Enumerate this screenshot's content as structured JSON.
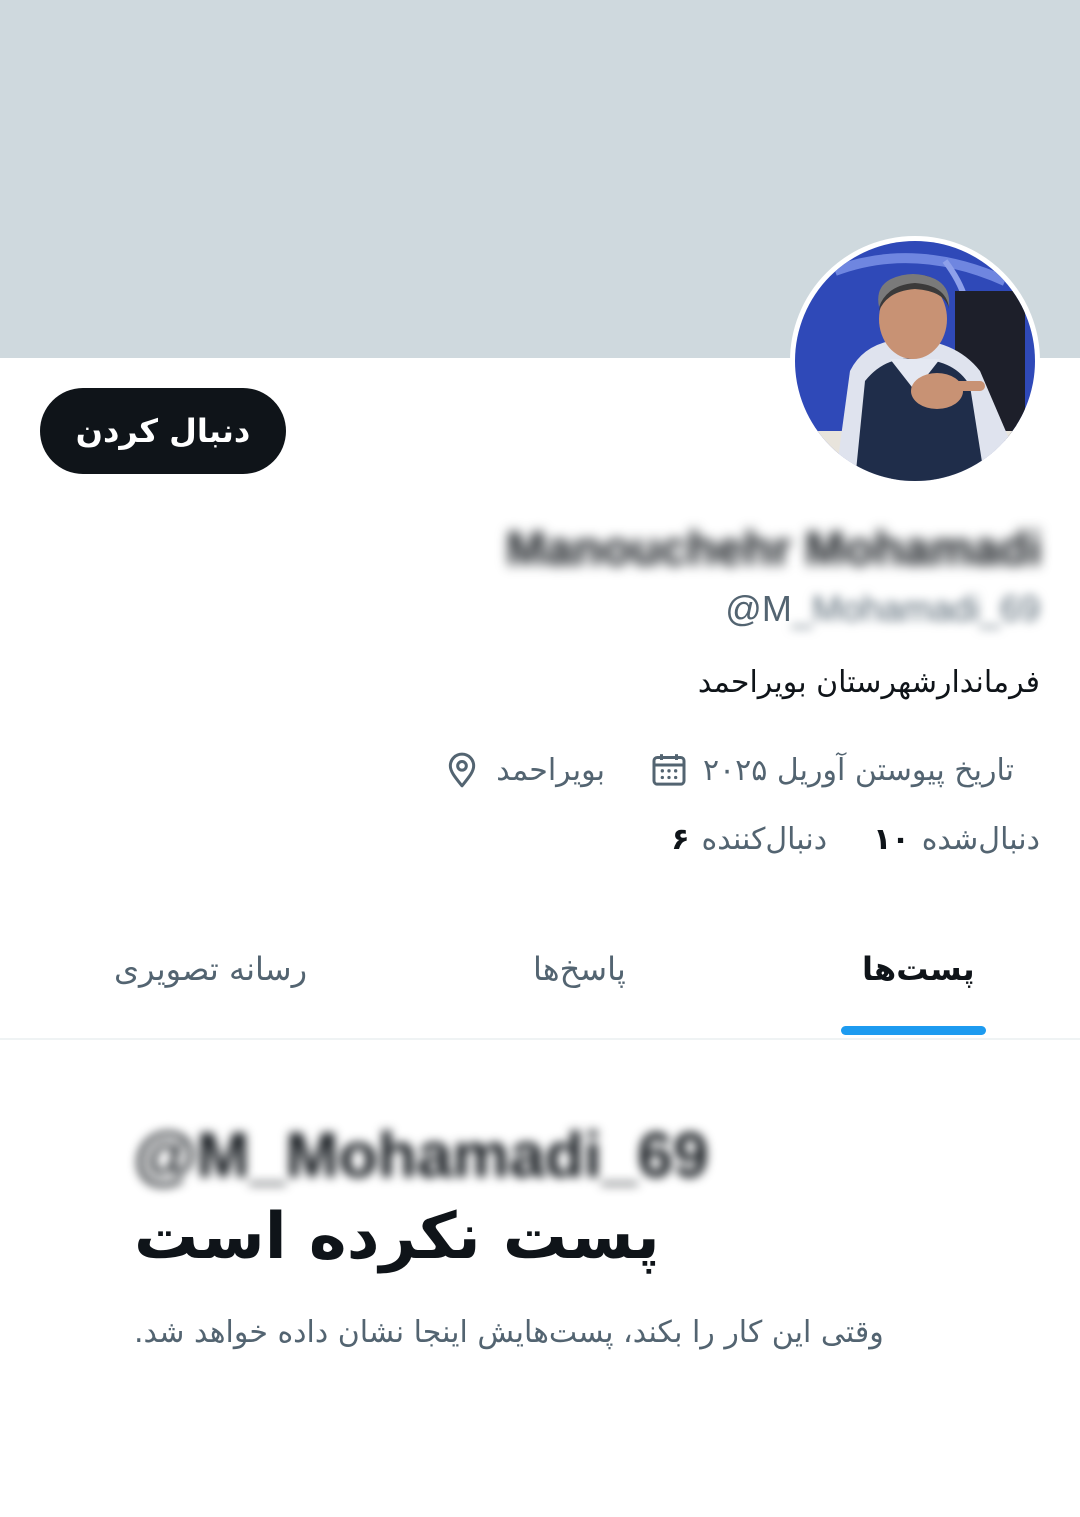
{
  "profile": {
    "display_name": "Manouchehr Mohamadi",
    "handle_prefix": "@M",
    "handle_rest": "_Mohamadi_69",
    "bio": "فرماندارشهرستان بویراحمد",
    "joined": "تاریخ پیوستن آوریل ۲۰۲۵",
    "location": "بویراحمد",
    "following_count": "۱۰",
    "following_label": "دنبال‌شده",
    "followers_count": "۶",
    "followers_label": "دنبال‌کننده"
  },
  "actions": {
    "follow_label": "دنبال کردن"
  },
  "tabs": [
    {
      "label": "پست‌ها",
      "active": true
    },
    {
      "label": "پاسخ‌ها",
      "active": false
    },
    {
      "label": "رسانه تصویری",
      "active": false
    }
  ],
  "empty_state": {
    "handle": "@M_Mohamadi_69",
    "title": "پست نکرده است",
    "subtitle": ".وقتی این کار را بکند، پست‌هایش اینجا نشان داده خواهد شد"
  },
  "colors": {
    "banner": "#cfd9de",
    "follow_button": "#0f1419",
    "tab_indicator": "#1d9bf0",
    "secondary_text": "#536471"
  },
  "icons": {
    "location": "map-pin-icon",
    "joined": "calendar-icon"
  }
}
